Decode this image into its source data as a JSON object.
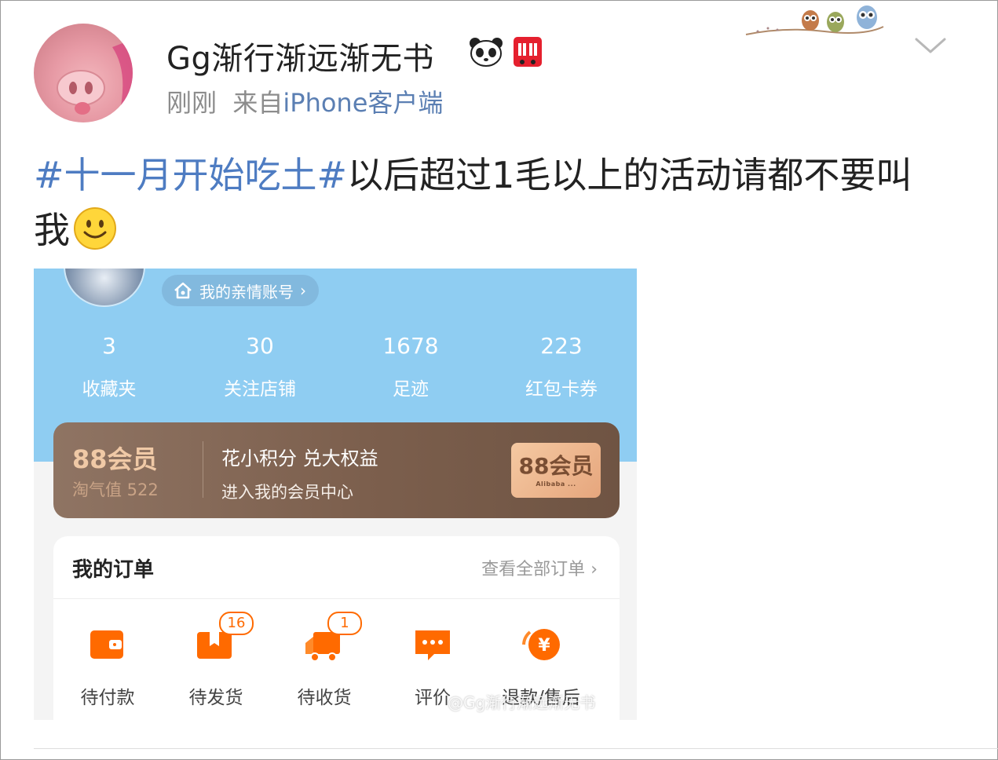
{
  "post": {
    "username": "Gg渐行渐远渐无书",
    "time": "刚刚",
    "source_prefix": "来自",
    "source": "iPhone客户端",
    "badges": [
      "panda-icon",
      "double11-icon"
    ],
    "hashtag": "#十一月开始吃土#",
    "text": "以后超过1毛以上的活动请都不要叫我",
    "emoji": "smiley-emoji"
  },
  "screenshot": {
    "family_account": "我的亲情账号",
    "stats": [
      {
        "value": "3",
        "label": "收藏夹"
      },
      {
        "value": "30",
        "label": "关注店铺"
      },
      {
        "value": "1678",
        "label": "足迹"
      },
      {
        "value": "223",
        "label": "红包卡券"
      }
    ],
    "vip": {
      "title": "88会员",
      "score": "淘气值 522",
      "slogan": "花小积分 兑大权益",
      "link": "进入我的会员中心",
      "badge_big": "88会员",
      "badge_small": "Alibaba ..."
    },
    "orders": {
      "title": "我的订单",
      "view_all": "查看全部订单",
      "items": [
        {
          "label": "待付款",
          "count": ""
        },
        {
          "label": "待发货",
          "count": "16"
        },
        {
          "label": "待收货",
          "count": "1"
        },
        {
          "label": "评价",
          "count": ""
        },
        {
          "label": "退款/售后",
          "count": ""
        }
      ]
    },
    "watermark": "@Gg渐行渐远渐无书"
  },
  "colors": {
    "hashtag": "#4e7cc2",
    "screenshot_header": "#8fcdf2",
    "taobao_orange": "#ff6a00",
    "vip_brown": "#7c5f4d"
  }
}
